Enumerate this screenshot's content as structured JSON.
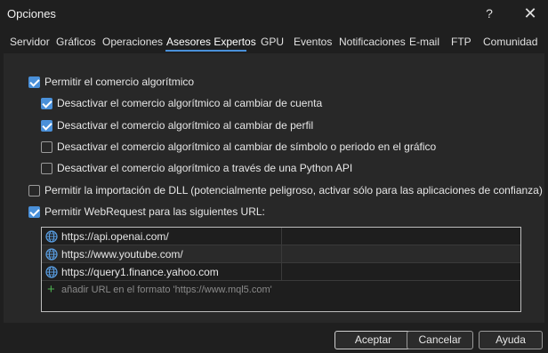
{
  "window": {
    "title": "Opciones",
    "help": "?",
    "close": "✕"
  },
  "tabs": [
    {
      "label": "Servidor"
    },
    {
      "label": "Gráficos"
    },
    {
      "label": "Operaciones"
    },
    {
      "label": "Asesores Expertos",
      "active": true
    },
    {
      "label": "GPU"
    },
    {
      "label": "Eventos"
    },
    {
      "label": "Notificaciones"
    },
    {
      "label": "E-mail"
    },
    {
      "label": "FTP"
    },
    {
      "label": "Comunidad"
    }
  ],
  "options": [
    {
      "label": "Permitir el comercio algorítmico",
      "checked": true
    },
    {
      "label": "Desactivar el comercio algorítmico al cambiar de cuenta",
      "checked": true
    },
    {
      "label": "Desactivar el comercio algorítmico al cambiar de perfil",
      "checked": true
    },
    {
      "label": "Desactivar el comercio algorítmico al cambiar de símbolo o periodo en el gráfico",
      "checked": false
    },
    {
      "label": "Desactivar el comercio algorítmico a través de una Python API",
      "checked": false
    },
    {
      "label": "Permitir la importación de DLL (potencialmente peligroso, activar sólo para las aplicaciones de confianza)",
      "checked": false
    },
    {
      "label": "Permitir WebRequest para las siguientes URL:",
      "checked": true
    }
  ],
  "urls": [
    {
      "url": "https://api.openai.com/"
    },
    {
      "url": "https://www.youtube.com/"
    },
    {
      "url": "https://query1.finance.yahoo.com"
    }
  ],
  "add_url": {
    "placeholder": "añadir URL en el formato 'https://www.mql5.com'"
  },
  "buttons": {
    "accept": "Aceptar",
    "cancel": "Cancelar",
    "help": "Ayuda"
  },
  "colors": {
    "accent": "#4a90d9",
    "add_icon": "#4caf50",
    "background": "#1f1f1f",
    "panel": "#282828"
  }
}
